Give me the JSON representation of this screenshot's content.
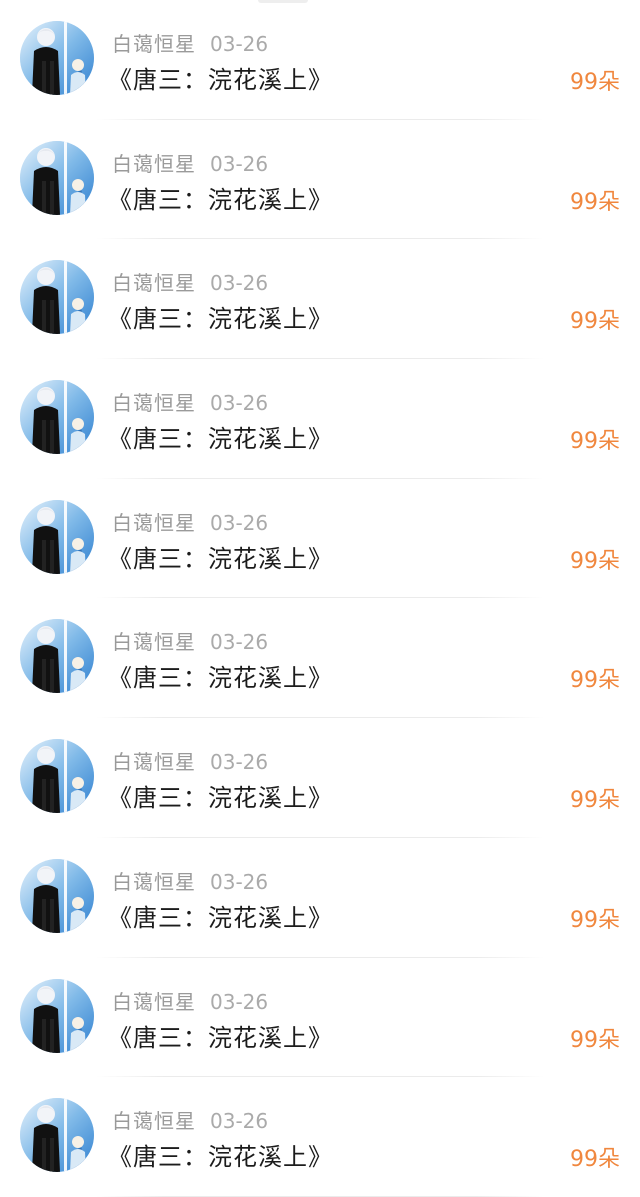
{
  "entries": [
    {
      "author": "白蔼恒星",
      "date": "03-26",
      "title": "《唐三：浣花溪上》",
      "count": "99朵"
    },
    {
      "author": "白蔼恒星",
      "date": "03-26",
      "title": "《唐三：浣花溪上》",
      "count": "99朵"
    },
    {
      "author": "白蔼恒星",
      "date": "03-26",
      "title": "《唐三：浣花溪上》",
      "count": "99朵"
    },
    {
      "author": "白蔼恒星",
      "date": "03-26",
      "title": "《唐三：浣花溪上》",
      "count": "99朵"
    },
    {
      "author": "白蔼恒星",
      "date": "03-26",
      "title": "《唐三：浣花溪上》",
      "count": "99朵"
    },
    {
      "author": "白蔼恒星",
      "date": "03-26",
      "title": "《唐三：浣花溪上》",
      "count": "99朵"
    },
    {
      "author": "白蔼恒星",
      "date": "03-26",
      "title": "《唐三：浣花溪上》",
      "count": "99朵"
    },
    {
      "author": "白蔼恒星",
      "date": "03-26",
      "title": "《唐三：浣花溪上》",
      "count": "99朵"
    },
    {
      "author": "白蔼恒星",
      "date": "03-26",
      "title": "《唐三：浣花溪上》",
      "count": "99朵"
    },
    {
      "author": "白蔼恒星",
      "date": "03-26",
      "title": "《唐三：浣花溪上》",
      "count": "99朵"
    }
  ],
  "icons": {
    "avatar": "user-avatar-anime-illustration"
  },
  "colors": {
    "count_accent": "#f0873e",
    "author_gray": "#9a9a9a",
    "title_text": "#1c1c1c"
  }
}
